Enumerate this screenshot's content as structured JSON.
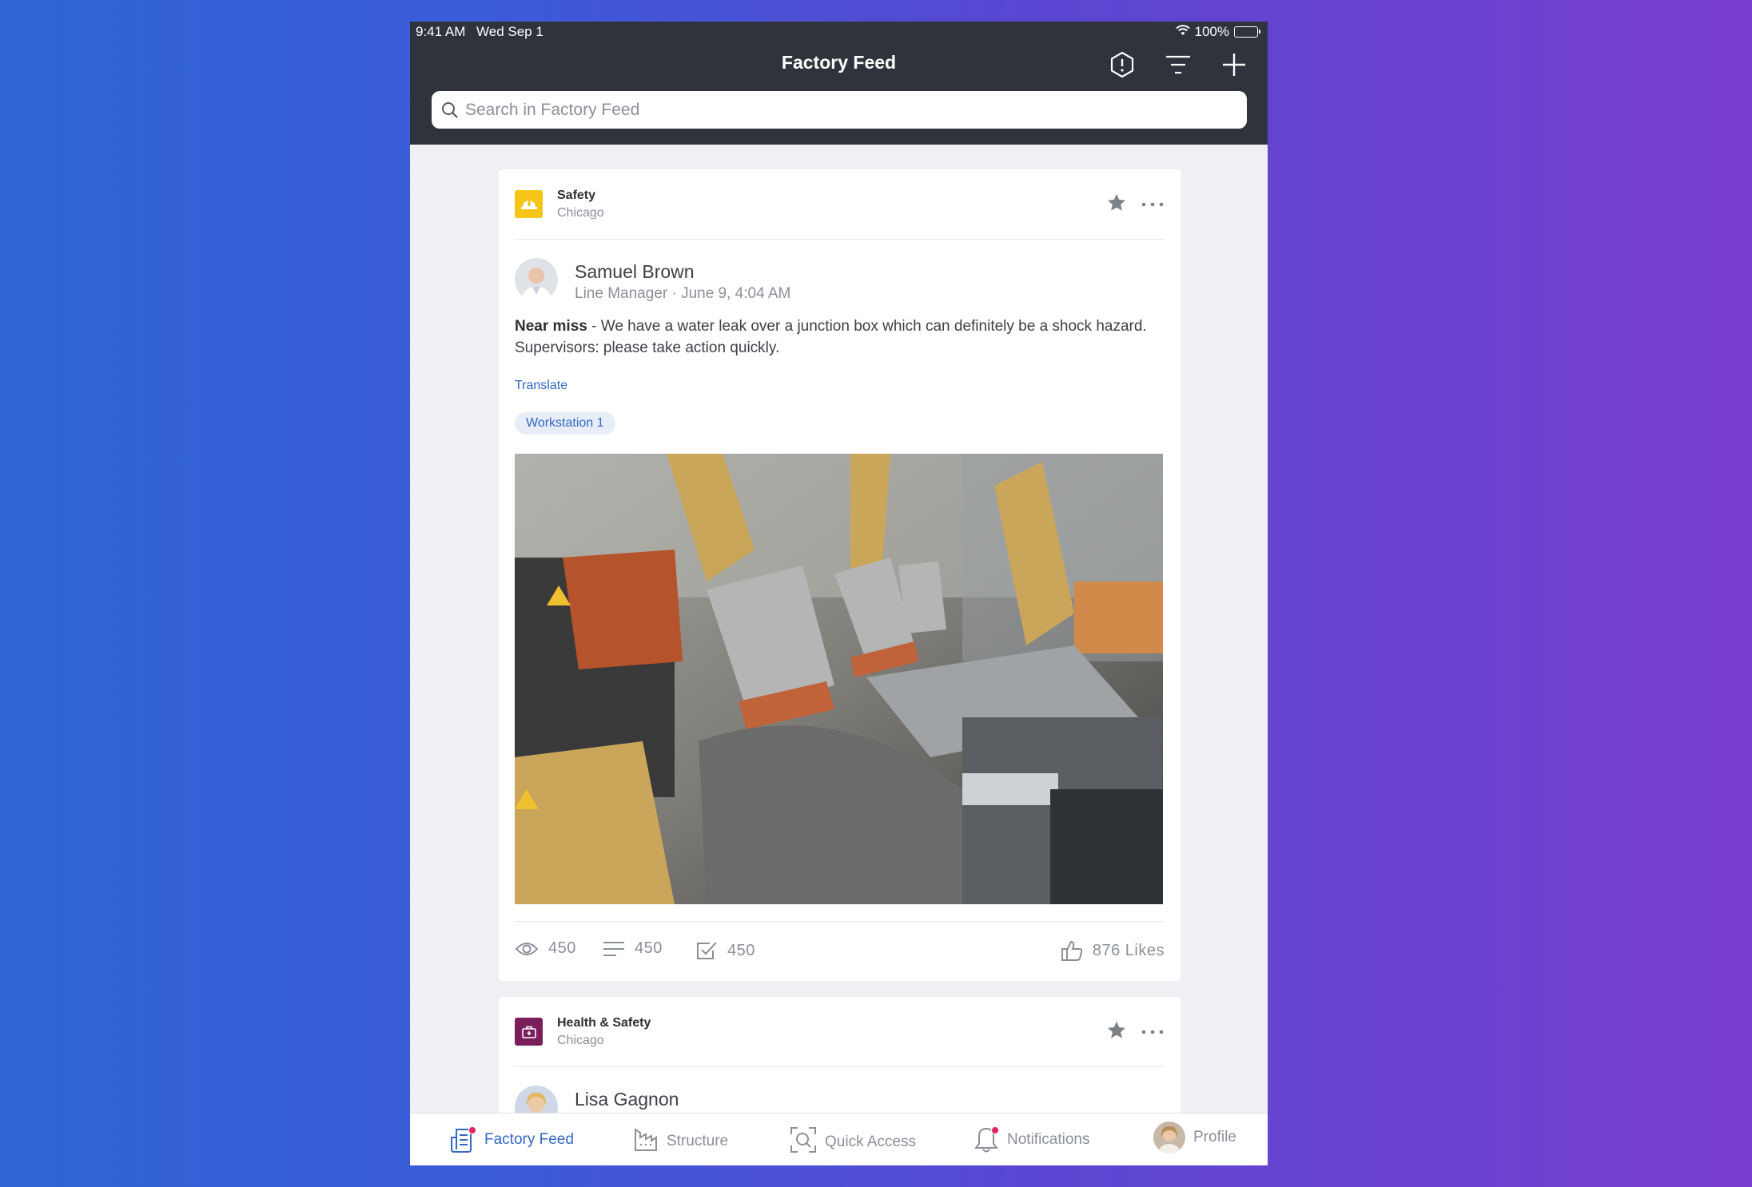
{
  "status": {
    "time": "9:41 AM",
    "date": "Wed Sep 1",
    "battery": "100%"
  },
  "nav": {
    "title": "Factory Feed"
  },
  "search": {
    "placeholder": "Search in Factory Feed"
  },
  "posts": [
    {
      "category": "Safety",
      "location": "Chicago",
      "category_color": "#f5c518",
      "author": "Samuel Brown",
      "meta": "Line Manager · June 9, 4:04 AM",
      "lead": "Near miss",
      "text": " - We have a water leak over a junction box which can definitely be a shock hazard. Supervisors: please take action quickly.",
      "translate": "Translate",
      "tag": "Workstation 1",
      "views": "450",
      "comments": "450",
      "tasks": "450",
      "likes": "876 Likes"
    },
    {
      "category": "Health & Safety",
      "location": "Chicago",
      "category_color": "#7a1f5c",
      "author": "Lisa Gagnon"
    }
  ],
  "tabs": [
    {
      "label": "Factory Feed",
      "icon": "feed-icon",
      "active": true
    },
    {
      "label": "Structure",
      "icon": "structure-icon"
    },
    {
      "label": "Quick Access",
      "icon": "scan-icon"
    },
    {
      "label": "Notifications",
      "icon": "bell-icon"
    },
    {
      "label": "Profile",
      "icon": "avatar"
    }
  ],
  "colors": {
    "accent": "#3367c4",
    "header": "#2e333c",
    "badge": "#e0245e"
  }
}
